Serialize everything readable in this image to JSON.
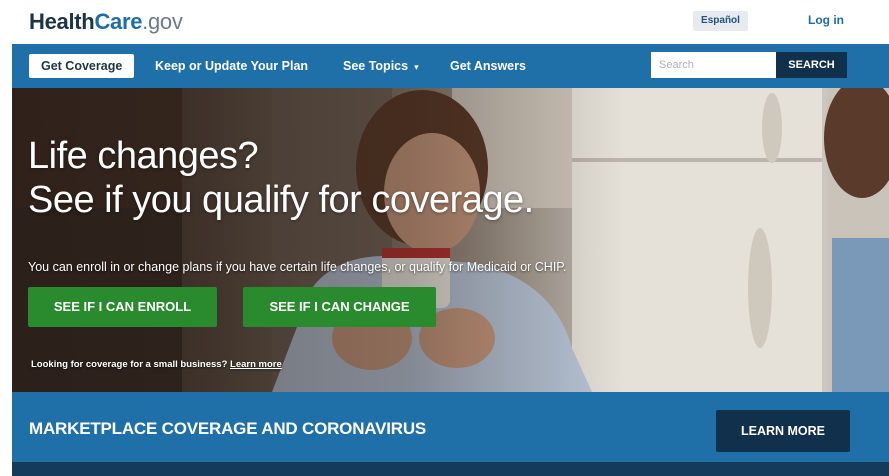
{
  "header": {
    "logo": {
      "part1": "Health",
      "part2": "Care",
      "part3": ".gov"
    },
    "language_label": "Español",
    "login_label": "Log in"
  },
  "nav": {
    "items": [
      {
        "label": "Get Coverage",
        "active": true
      },
      {
        "label": "Keep or Update Your Plan",
        "active": false
      },
      {
        "label": "See Topics",
        "active": false,
        "has_dropdown": true
      },
      {
        "label": "Get Answers",
        "active": false
      }
    ],
    "search": {
      "placeholder": "Search",
      "value": "",
      "button_label": "SEARCH"
    }
  },
  "hero": {
    "headline_line1": "Life changes?",
    "headline_line2": "See if you qualify for coverage.",
    "subtext": "You can enroll in or change plans if you have certain life changes, or qualify for Medicaid or CHIP.",
    "cta_enroll": "SEE IF I CAN ENROLL",
    "cta_change": "SEE IF I CAN CHANGE",
    "small_business_text": "Looking for coverage for a small business?",
    "small_business_link": "Learn more"
  },
  "banner": {
    "title": "MARKETPLACE COVERAGE AND CORONAVIRUS",
    "button_label": "LEARN MORE"
  },
  "colors": {
    "nav_blue": "#1f6fa8",
    "dark_navy": "#11304b",
    "cta_green": "#2a8a2e",
    "logo_blue": "#1d6ea7"
  }
}
